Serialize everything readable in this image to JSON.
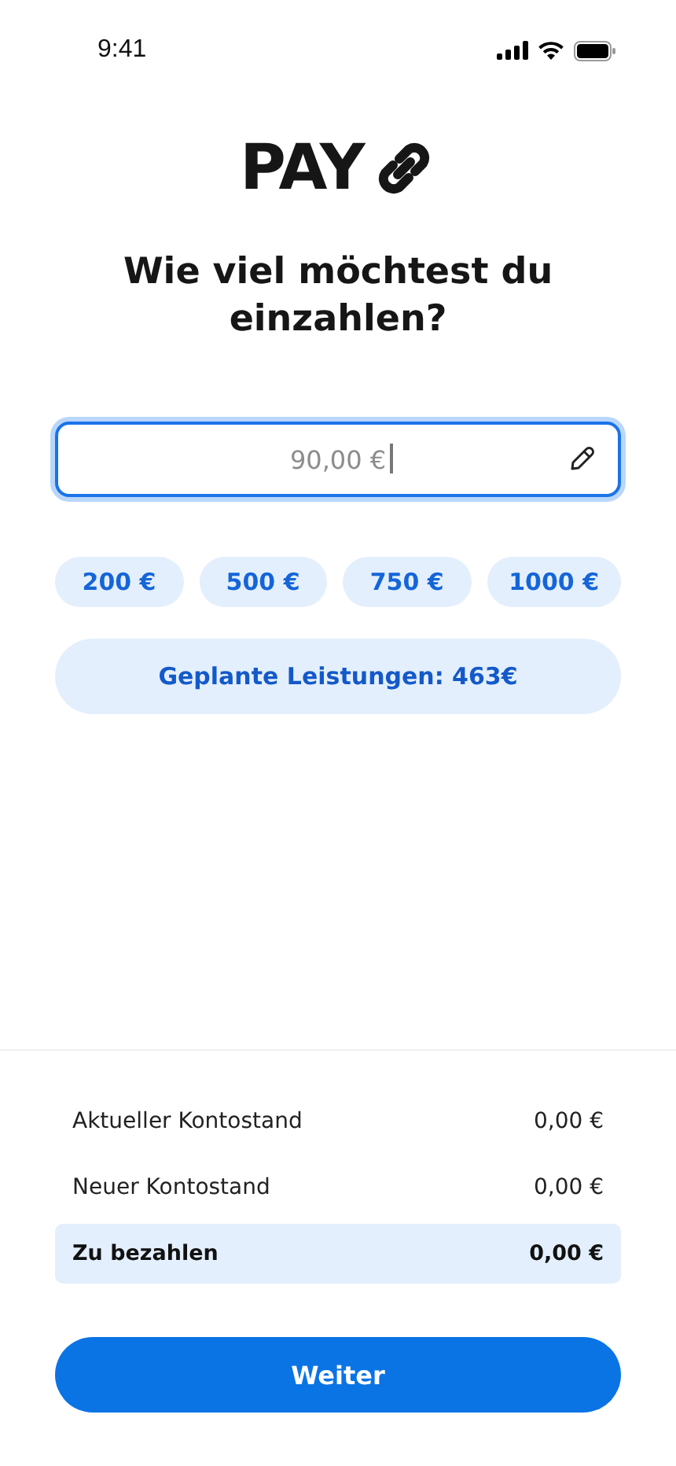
{
  "status_bar": {
    "time": "9:41"
  },
  "logo": {
    "text": "PAY"
  },
  "heading": "Wie viel möchtest du einzahlen?",
  "amount_field": {
    "placeholder": "90,00 €",
    "focused": true
  },
  "quick_amounts": [
    {
      "label": "200 €",
      "selected": false
    },
    {
      "label": "500 €",
      "selected": false
    },
    {
      "label": "750 €",
      "selected": false
    },
    {
      "label": "1000 €",
      "selected": false
    }
  ],
  "planned_button": "Geplante Leistungen: 463€",
  "summary": [
    {
      "label": "Aktueller Kontostand",
      "value": "0,00 €",
      "kind": "plain"
    },
    {
      "label": "Neuer Kontostand",
      "value": "0,00 €",
      "kind": "plain"
    },
    {
      "label": "Zu bezahlen",
      "value": "0,00 €",
      "kind": "total"
    }
  ],
  "primary_button": "Weiter"
}
